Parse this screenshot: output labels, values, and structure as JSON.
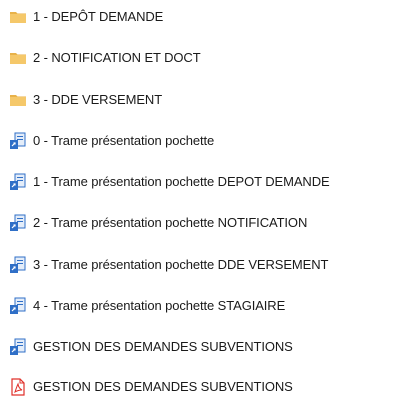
{
  "files": [
    {
      "label": "1 - DEPÔT DEMANDE",
      "icon": "folder-icon"
    },
    {
      "label": "2 - NOTIFICATION ET DOCT",
      "icon": "folder-icon"
    },
    {
      "label": "3 - DDE VERSEMENT",
      "icon": "folder-icon"
    },
    {
      "label": "0 - Trame présentation pochette",
      "icon": "document-shortcut-icon"
    },
    {
      "label": "1 - Trame présentation pochette DEPOT DEMANDE",
      "icon": "document-shortcut-icon"
    },
    {
      "label": "2 - Trame présentation pochette NOTIFICATION",
      "icon": "document-shortcut-icon"
    },
    {
      "label": "3 - Trame présentation pochette DDE VERSEMENT",
      "icon": "document-shortcut-icon"
    },
    {
      "label": "4 - Trame présentation pochette STAGIAIRE",
      "icon": "document-shortcut-icon"
    },
    {
      "label": "GESTION DES DEMANDES SUBVENTIONS",
      "icon": "document-shortcut-icon"
    },
    {
      "label": "GESTION DES DEMANDES SUBVENTIONS",
      "icon": "pdf-icon"
    }
  ],
  "colors": {
    "folder": "#f5c86a",
    "folder_tab": "#e8b24a",
    "doc_blue": "#2f6fc7",
    "doc_light": "#e4edf9",
    "pdf_red": "#e0302a",
    "text": "#1a1a1a"
  }
}
